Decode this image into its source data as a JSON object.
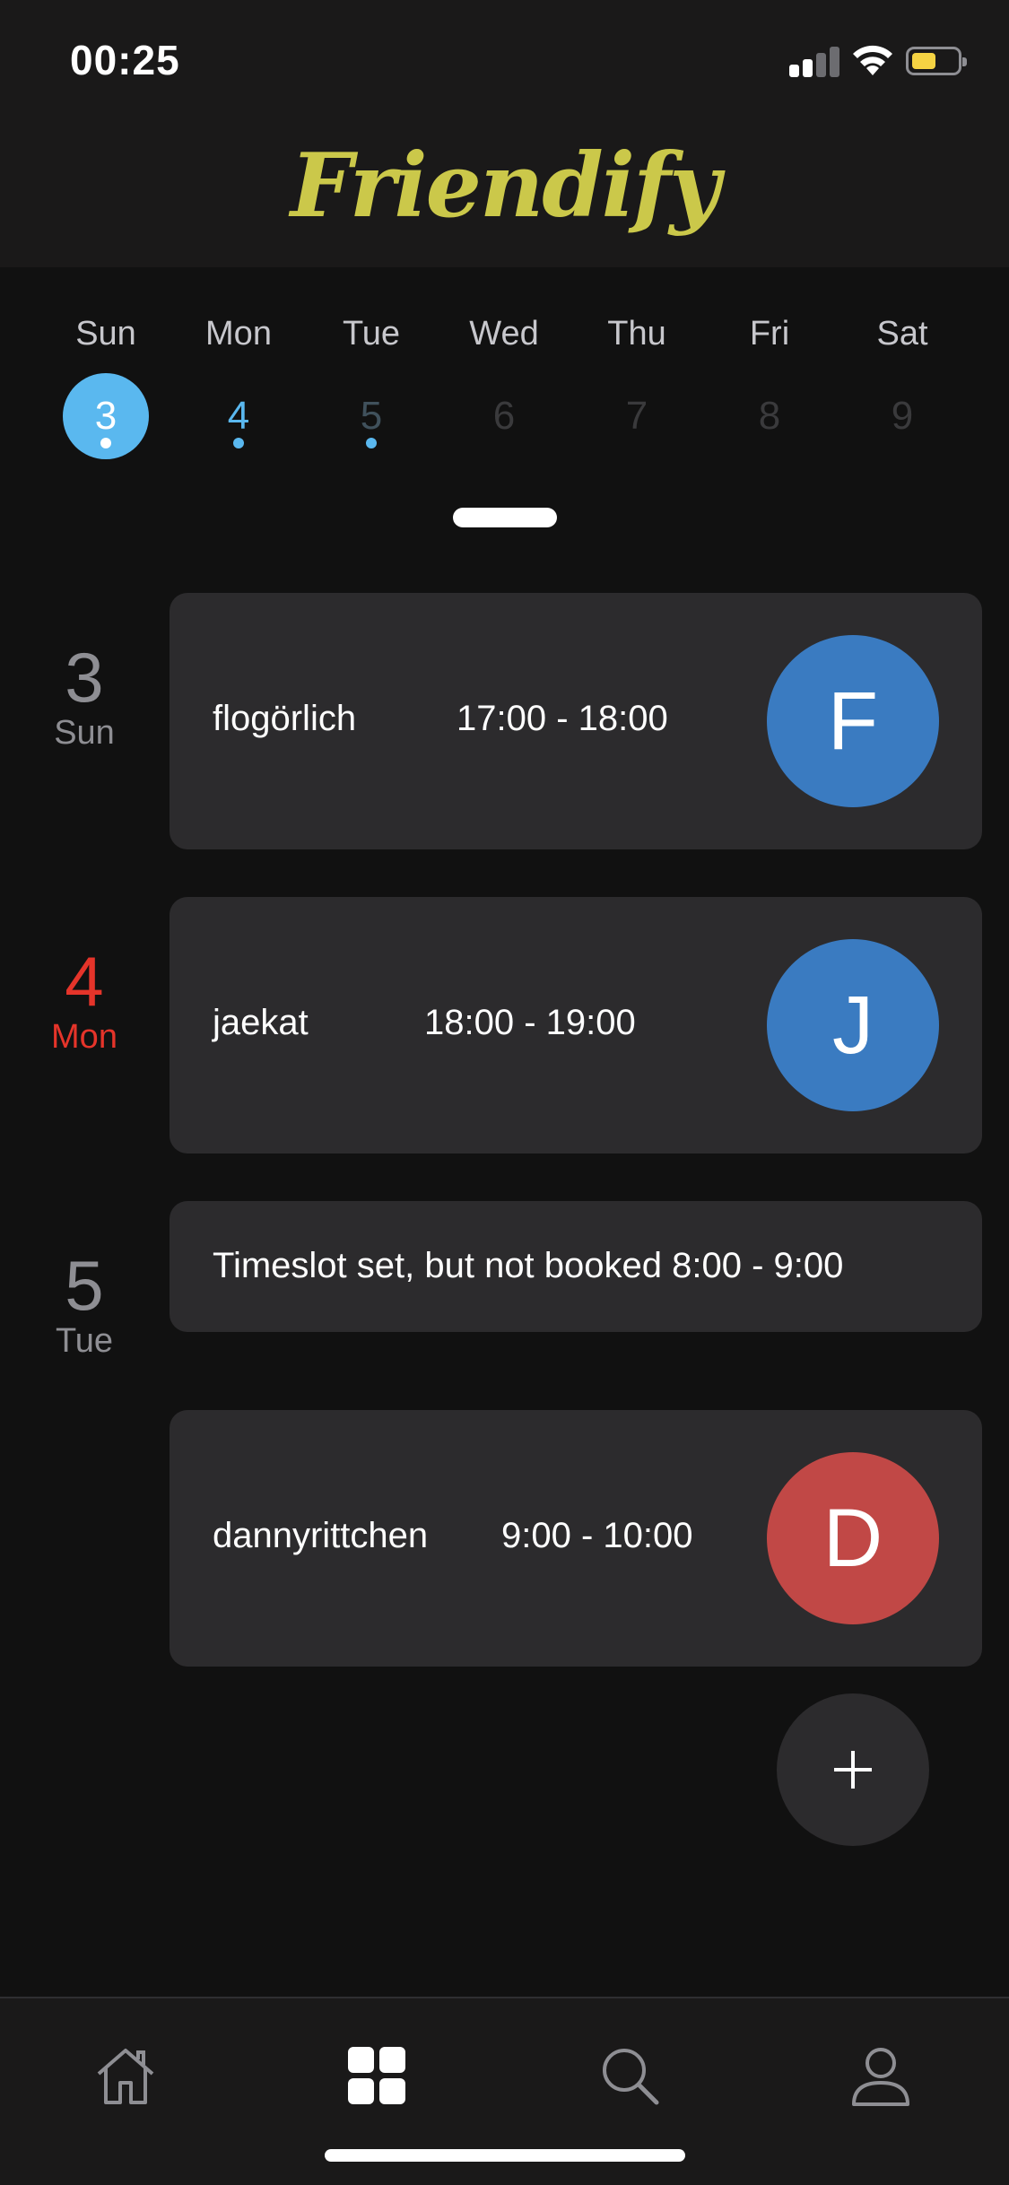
{
  "status_bar": {
    "time": "00:25",
    "signal_bars_active": 2,
    "battery_level": 0.45
  },
  "header": {
    "app_title": "Friendify"
  },
  "week": {
    "days": [
      {
        "name": "Sun",
        "number": "3",
        "state": "selected",
        "has_event": true
      },
      {
        "name": "Mon",
        "number": "4",
        "state": "today",
        "has_event": true
      },
      {
        "name": "Tue",
        "number": "5",
        "state": "upcoming",
        "has_event": true
      },
      {
        "name": "Wed",
        "number": "6",
        "state": "empty",
        "has_event": false
      },
      {
        "name": "Thu",
        "number": "7",
        "state": "empty",
        "has_event": false
      },
      {
        "name": "Fri",
        "number": "8",
        "state": "empty",
        "has_event": false
      },
      {
        "name": "Sat",
        "number": "9",
        "state": "empty",
        "has_event": false
      }
    ]
  },
  "agenda": {
    "groups": [
      {
        "day_number": "3",
        "day_name": "Sun",
        "is_today": false
      },
      {
        "day_number": "4",
        "day_name": "Mon",
        "is_today": true
      },
      {
        "day_number": "5",
        "day_name": "Tue",
        "is_today": false
      }
    ],
    "events": [
      {
        "title": "flogörlich",
        "time": "17:00 - 18:00",
        "avatar_letter": "F",
        "avatar_color": "#3a7bc1"
      },
      {
        "title": "jaekat",
        "time": "18:00 - 19:00",
        "avatar_letter": "J",
        "avatar_color": "#3a7bc1"
      },
      {
        "slot_text": "Timeslot set, but not booked 8:00 - 9:00"
      },
      {
        "title": "dannyrittchen",
        "time": "9:00 - 10:00",
        "avatar_letter": "D",
        "avatar_color": "#c14846"
      }
    ]
  },
  "fab": {
    "icon": "plus-icon"
  },
  "tab_bar": {
    "tabs": [
      {
        "icon": "home-icon",
        "active": false
      },
      {
        "icon": "grid-icon",
        "active": true
      },
      {
        "icon": "search-icon",
        "active": false
      },
      {
        "icon": "profile-icon",
        "active": false
      }
    ]
  },
  "colors": {
    "brand_title": "#cbc84a",
    "accent_blue": "#5ab8ef",
    "today_red": "#e5342a",
    "card_bg": "#2c2b2d"
  }
}
